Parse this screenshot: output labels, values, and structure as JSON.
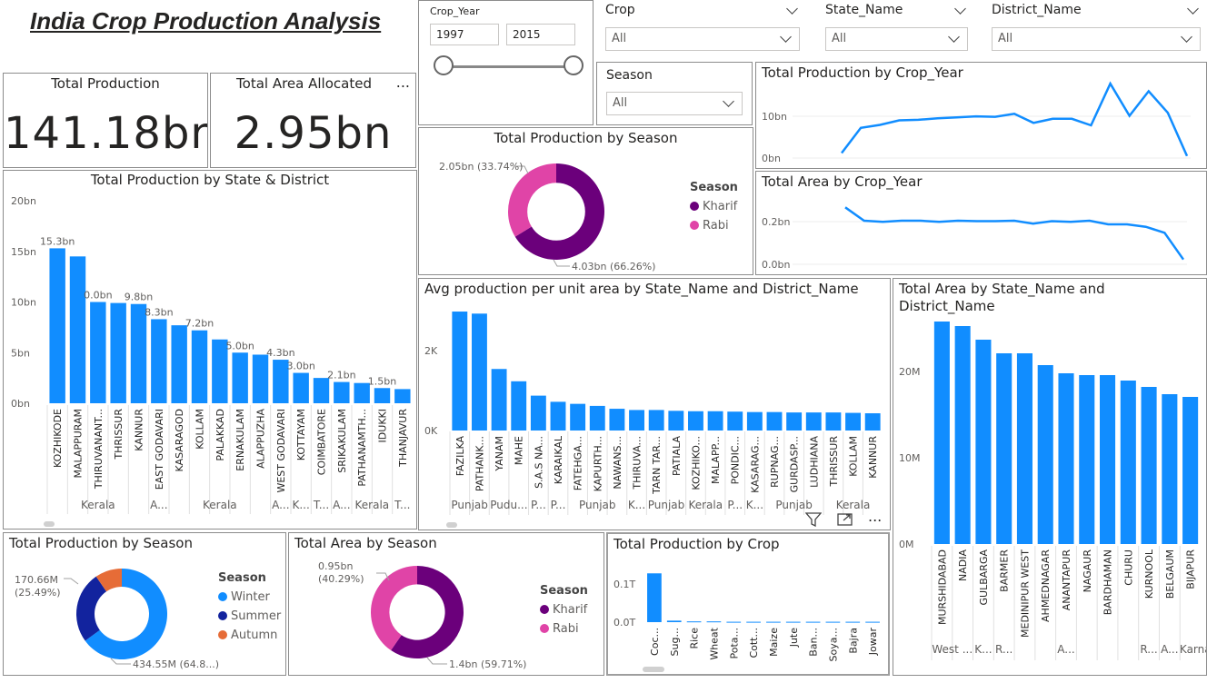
{
  "title": "India Crop Production Analysis",
  "colors": {
    "accent": "#118DFF",
    "kharif": "#6B007B",
    "rabi": "#E044A7",
    "winter": "#118DFF",
    "summer": "#12239E",
    "autumn": "#E66C37"
  },
  "crop_year": {
    "title": "Crop_Year",
    "start": "1997",
    "end": "2015"
  },
  "slicers": {
    "crop": {
      "title": "Crop",
      "value": "All"
    },
    "state": {
      "title": "State_Name",
      "value": "All"
    },
    "district": {
      "title": "District_Name",
      "value": "All"
    },
    "season": {
      "title": "Season",
      "value": "All"
    }
  },
  "cards": {
    "production": {
      "label": "Total Production",
      "value": "141.18bn"
    },
    "area": {
      "label": "Total Area Allocated",
      "value": "2.95bn",
      "more": "..."
    }
  },
  "chart_data": [
    {
      "id": "prod_state_district",
      "type": "bar",
      "title": "Total Production by State & District",
      "ylim": [
        0,
        20
      ],
      "yticks": [
        "0bn",
        "5bn",
        "10bn",
        "15bn",
        "20bn"
      ],
      "categories": [
        "KOZHIKODE",
        "MALAPPURAM",
        "THIRUVANANT...",
        "THRISSUR",
        "KANNUR",
        "EAST GODAVARI",
        "KASARAGOD",
        "KOLLAM",
        "PALAKKAD",
        "ERNAKULAM",
        "ALAPPUZHA",
        "WEST GODAVARI",
        "KOTTAYAM",
        "COIMBATORE",
        "SRIKAKULAM",
        "PATHANAMTH...",
        "IDUKKI",
        "THANJAVUR"
      ],
      "values": [
        15.3,
        14.5,
        10.0,
        9.9,
        9.8,
        8.3,
        7.7,
        7.2,
        6.3,
        5.0,
        4.8,
        4.3,
        3.0,
        2.5,
        2.1,
        2.0,
        1.5,
        1.4
      ],
      "data_labels": [
        "15.3bn",
        "",
        "0.0bn",
        "",
        "9.8bn",
        "8.3bn",
        "",
        "7.2bn",
        "",
        "5.0bn",
        "",
        "4.3bn",
        "3.0bn",
        "",
        "2.1bn",
        "",
        "1.5bn",
        ""
      ],
      "groups": [
        {
          "label": "Kerala",
          "span": 5
        },
        {
          "label": "A...",
          "span": 1
        },
        {
          "label": "Kerala",
          "span": 5
        },
        {
          "label": "A...",
          "span": 1
        },
        {
          "label": "K...",
          "span": 1
        },
        {
          "label": "T...",
          "span": 1
        },
        {
          "label": "A...",
          "span": 1
        },
        {
          "label": "Kerala",
          "span": 2
        },
        {
          "label": "T...",
          "span": 1
        }
      ]
    },
    {
      "id": "prod_season_top",
      "type": "pie",
      "title": "Total Production by Season",
      "legend_title": "Season",
      "series": [
        {
          "name": "Kharif",
          "value": 4.03,
          "label": "4.03bn (66.26%)"
        },
        {
          "name": "Rabi",
          "value": 2.05,
          "label": "2.05bn (33.74%)"
        }
      ]
    },
    {
      "id": "prod_year",
      "type": "line",
      "title": "Total Production by Crop_Year",
      "yticks": [
        "0bn",
        "10bn"
      ],
      "ylim": [
        0,
        15
      ],
      "x": [
        1997,
        1998,
        1999,
        2000,
        2001,
        2002,
        2003,
        2004,
        2005,
        2006,
        2007,
        2008,
        2009,
        2010,
        2011,
        2012,
        2013,
        2014,
        2015
      ],
      "values": [
        1.0,
        6.0,
        6.6,
        7.5,
        7.6,
        7.9,
        8.1,
        8.3,
        8.2,
        8.8,
        7.0,
        7.8,
        7.8,
        6.5,
        14.8,
        8.4,
        13.3,
        9.0,
        0.4
      ]
    },
    {
      "id": "area_year",
      "type": "line",
      "title": "Total Area by Crop_Year",
      "yticks": [
        "0.0bn",
        "0.2bn"
      ],
      "ylim": [
        0,
        0.3
      ],
      "x": [
        1997,
        1998,
        1999,
        2000,
        2001,
        2002,
        2003,
        2004,
        2005,
        2006,
        2007,
        2008,
        2009,
        2010,
        2011,
        2012,
        2013,
        2014,
        2015
      ],
      "values": [
        0.235,
        0.18,
        0.175,
        0.18,
        0.18,
        0.175,
        0.18,
        0.178,
        0.178,
        0.18,
        0.168,
        0.178,
        0.175,
        0.18,
        0.165,
        0.165,
        0.155,
        0.13,
        0.02
      ]
    },
    {
      "id": "avg_prod",
      "type": "bar",
      "title": "Avg production per unit area by State_Name and District_Name",
      "ylim": [
        0,
        3.1
      ],
      "yticks": [
        "0K",
        "2K"
      ],
      "categories": [
        "FAZILKA",
        "PATHANK...",
        "YANAM",
        "MAHE",
        "S.A.S NA...",
        "KARAIKAL",
        "FATEHGA...",
        "KAPURTH...",
        "NAWANS...",
        "THIRUVA...",
        "TARN TAR...",
        "PATIALA",
        "KOZHIKO...",
        "MALAPP...",
        "PONDIC...",
        "KASARAG...",
        "RUPNAG...",
        "GURDASP...",
        "LUDHIANA",
        "THRISSUR",
        "KOLLAM",
        "KANNUR"
      ],
      "values": [
        2.9,
        2.85,
        1.5,
        1.2,
        0.85,
        0.7,
        0.65,
        0.6,
        0.53,
        0.5,
        0.5,
        0.48,
        0.47,
        0.47,
        0.46,
        0.45,
        0.45,
        0.44,
        0.44,
        0.44,
        0.43,
        0.42
      ],
      "groups": [
        {
          "label": "Punjab",
          "span": 2
        },
        {
          "label": "Pudu...",
          "span": 2
        },
        {
          "label": "P...",
          "span": 1
        },
        {
          "label": "P...",
          "span": 1
        },
        {
          "label": "Punjab",
          "span": 3
        },
        {
          "label": "K...",
          "span": 1
        },
        {
          "label": "Punjab",
          "span": 2
        },
        {
          "label": "Kerala",
          "span": 2
        },
        {
          "label": "P...",
          "span": 1
        },
        {
          "label": "K...",
          "span": 1
        },
        {
          "label": "Punjab",
          "span": 3
        },
        {
          "label": "Kerala",
          "span": 3
        }
      ]
    },
    {
      "id": "area_state_district",
      "type": "bar",
      "title": "Total Area by State_Name and District_Name",
      "ylim": [
        0,
        27
      ],
      "yticks": [
        "0M",
        "10M",
        "20M"
      ],
      "categories": [
        "MURSHIDABAD",
        "NADIA",
        "GULBARGA",
        "BARMER",
        "MEDINIPUR WEST",
        "AHMEDNAGAR",
        "ANANTAPUR",
        "NAGAUR",
        "BARDHAMAN",
        "CHURU",
        "KURNOOL",
        "BELGAUM",
        "BIJAPUR"
      ],
      "values": [
        24.5,
        24.0,
        22.5,
        21.0,
        21.0,
        19.7,
        18.8,
        18.6,
        18.6,
        18.0,
        17.3,
        16.5,
        16.2
      ],
      "groups": [
        {
          "label": "West ...",
          "span": 2
        },
        {
          "label": "K...",
          "span": 1
        },
        {
          "label": "R...",
          "span": 1
        },
        {
          "label": "",
          "span": 1
        },
        {
          "label": "",
          "span": 1
        },
        {
          "label": "A...",
          "span": 1
        },
        {
          "label": "",
          "span": 2
        },
        {
          "label": "",
          "span": 1
        },
        {
          "label": "R...",
          "span": 1
        },
        {
          "label": "A...",
          "span": 1
        },
        {
          "label": "Karna...",
          "span": 2
        }
      ]
    },
    {
      "id": "prod_season_bottom",
      "type": "pie",
      "title": "Total Production by Season",
      "legend_title": "Season",
      "series": [
        {
          "name": "Winter",
          "value": 434.55,
          "label": "434.55M (64.8...)"
        },
        {
          "name": "Summer",
          "value": 170.66,
          "label": "170.66M (25.49%)"
        },
        {
          "name": "Autumn",
          "value": 64.0,
          "label": ""
        }
      ]
    },
    {
      "id": "area_season",
      "type": "pie",
      "title": "Total Area by Season",
      "legend_title": "Season",
      "series": [
        {
          "name": "Kharif",
          "value": 1.4,
          "label": "1.4bn (59.71%)"
        },
        {
          "name": "Rabi",
          "value": 0.95,
          "label": "0.95bn (40.29%)"
        }
      ]
    },
    {
      "id": "prod_crop",
      "type": "bar",
      "title": "Total Production by Crop",
      "ylim": [
        0,
        0.15
      ],
      "yticks": [
        "0.0T",
        "0.1T"
      ],
      "categories": [
        "Coc...",
        "Sug...",
        "Rice",
        "Wheat",
        "Pota...",
        "Cott...",
        "Maize",
        "Jute",
        "Ban...",
        "Soya...",
        "Bajra",
        "Jowar"
      ],
      "values": [
        0.13,
        0.004,
        0.002,
        0.002,
        0.001,
        0.001,
        0.001,
        0.001,
        0.001,
        0.001,
        0.001,
        0.001
      ]
    }
  ]
}
